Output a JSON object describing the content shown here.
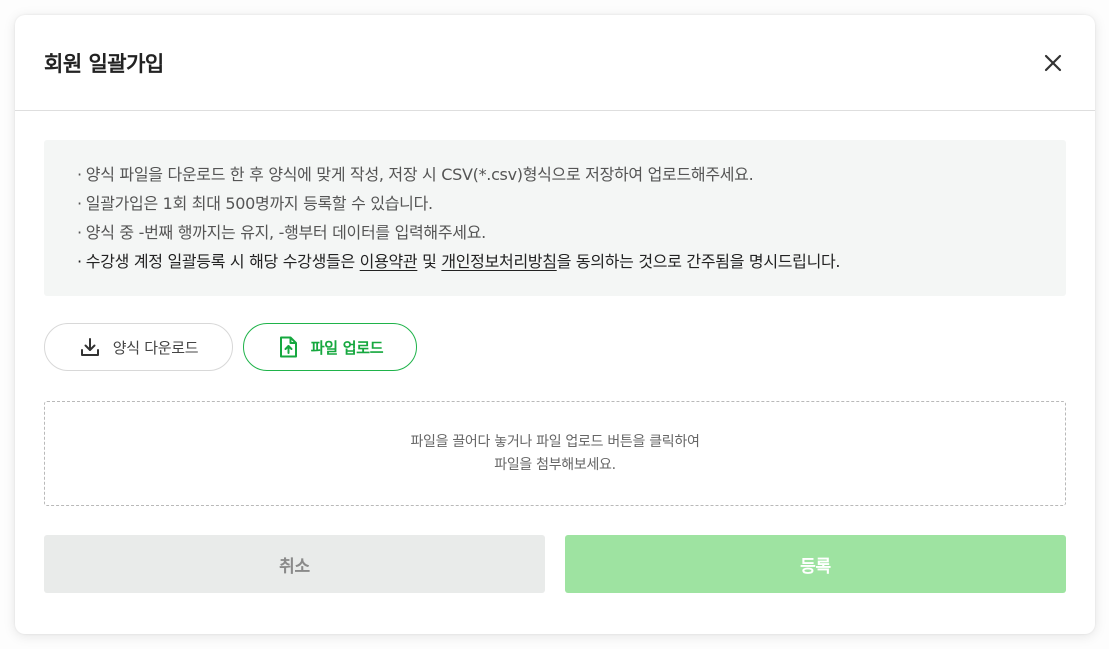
{
  "modal": {
    "title": "회원 일괄가입",
    "close_icon": "close-icon"
  },
  "notice": {
    "bullet": "·",
    "line1": "양식 파일을 다운로드 한 후 양식에 맞게 작성, 저장 시 CSV(*.csv)형식으로 저장하여 업로드해주세요.",
    "line2": "일괄가입은 1회 최대 500명까지 등록할 수 있습니다.",
    "line3": "양식 중 -번째 행까지는 유지, -행부터 데이터를 입력해주세요.",
    "line4_prefix": "수강생 계정 일괄등록 시 해당 수강생들은 ",
    "terms_link": "이용약관",
    "line4_and": " 및 ",
    "privacy_link": "개인정보처리방침",
    "line4_suffix": "을 동의하는 것으로 간주됨을 명시드립니다."
  },
  "actions": {
    "download_label": "양식 다운로드",
    "download_icon": "download-icon",
    "upload_label": "파일 업로드",
    "upload_icon": "file-upload-icon"
  },
  "dropzone": {
    "line1": "파일을 끌어다 놓거나 파일 업로드 버튼을 클릭하여",
    "line2": "파일을 첨부해보세요."
  },
  "footer": {
    "cancel_label": "취소",
    "submit_label": "등록"
  },
  "colors": {
    "accent": "#1fb34a",
    "submit_disabled": "#9ee3a1",
    "cancel_bg": "#e9ebea",
    "notice_bg": "#f4f6f5"
  }
}
